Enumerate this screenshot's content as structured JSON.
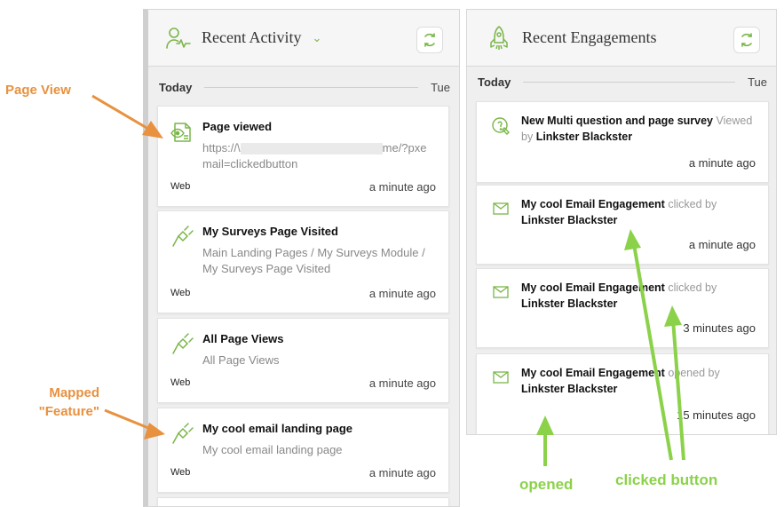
{
  "colors": {
    "accent": "#7ab648",
    "annotation_orange": "#e8913e",
    "annotation_green": "#8bd24a"
  },
  "activity": {
    "title": "Recent Activity",
    "day": "Today",
    "weekday": "Tue",
    "header_icon": "user-activity-icon",
    "items": [
      {
        "title": "Page viewed",
        "sub_prefix": "https://\\",
        "sub_suffix": "me/?pxe",
        "sub_line2": "mail=clickedbutton",
        "source": "Web",
        "time": "a minute ago",
        "icon": "page-view-icon"
      },
      {
        "title": "My Surveys Page Visited",
        "sub": "Main Landing Pages / My Surveys Module / My Surveys Page Visited",
        "source": "Web",
        "time": "a minute ago",
        "icon": "plug-icon"
      },
      {
        "title": "All Page Views",
        "sub": "All Page Views",
        "source": "Web",
        "time": "a minute ago",
        "icon": "plug-icon"
      },
      {
        "title": "My cool email landing page",
        "sub": "My cool email landing page",
        "source": "Web",
        "time": "a minute ago",
        "icon": "plug-icon"
      }
    ]
  },
  "engagements": {
    "title": "Recent Engagements",
    "day": "Today",
    "weekday": "Tue",
    "header_icon": "rocket-icon",
    "items": [
      {
        "name": "New Multi question and page survey",
        "action": "Viewed",
        "by": "by",
        "person": "Linkster Blackster",
        "time": "a minute ago",
        "icon": "survey-icon"
      },
      {
        "name": "My cool Email Engagement",
        "action": "clicked by",
        "person": "Linkster Blackster",
        "time": "a minute ago",
        "icon": "email-icon"
      },
      {
        "name": "My cool Email Engagement",
        "action": "clicked by",
        "person": "Linkster Blackster",
        "time": "3 minutes ago",
        "icon": "email-icon"
      },
      {
        "name": "My cool Email Engagement",
        "action": "opened by",
        "person": "Linkster Blackster",
        "time": "15 minutes ago",
        "icon": "email-icon"
      }
    ]
  },
  "annotations": {
    "page_view": "Page View",
    "mapped_line1": "Mapped",
    "mapped_line2": "\"Feature\"",
    "opened": "opened",
    "clicked_button": "clicked button"
  }
}
